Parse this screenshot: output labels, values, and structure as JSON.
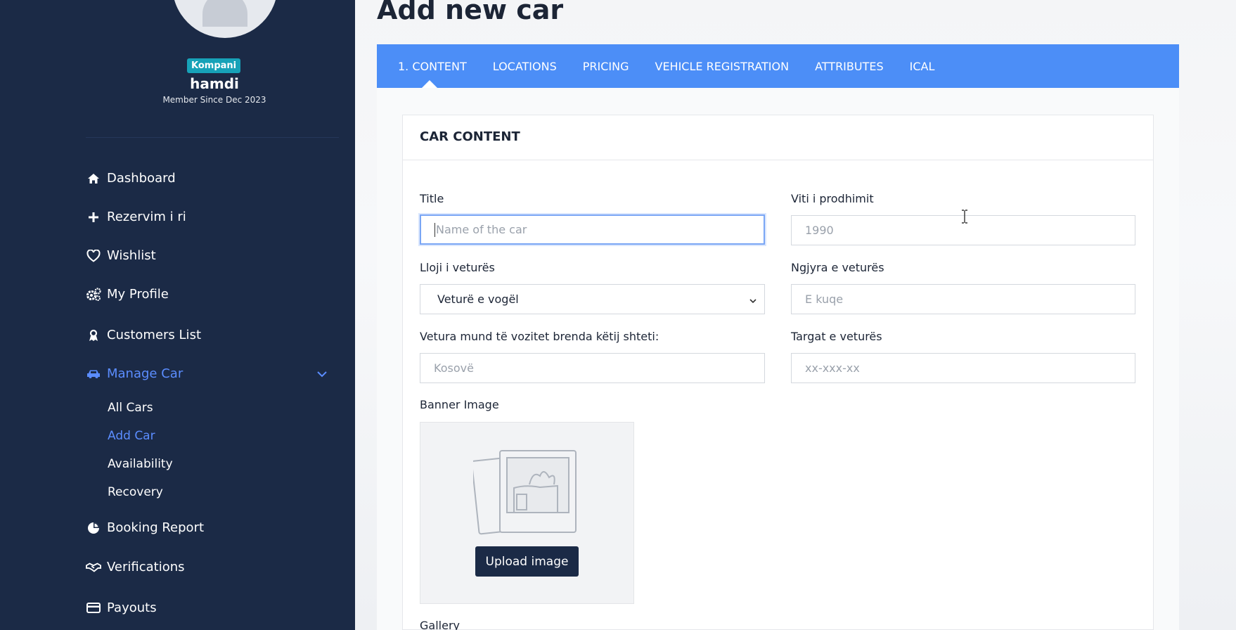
{
  "profile": {
    "badge": "Kompani",
    "username": "hamdi",
    "member_since": "Member Since Dec 2023"
  },
  "sidebar": {
    "items": [
      {
        "label": "Dashboard",
        "icon": "home-icon"
      },
      {
        "label": "Rezervim i ri",
        "icon": "plus-icon"
      },
      {
        "label": "Wishlist",
        "icon": "heart-icon"
      },
      {
        "label": "My Profile",
        "icon": "gears-icon"
      },
      {
        "label": "Customers List",
        "icon": "user-badge-icon"
      },
      {
        "label": "Manage Car",
        "icon": "car-icon",
        "active": true
      },
      {
        "label": "Booking Report",
        "icon": "pie-chart-icon"
      },
      {
        "label": "Verifications",
        "icon": "handshake-icon"
      },
      {
        "label": "Payouts",
        "icon": "credit-card-icon"
      }
    ],
    "sub_items": [
      {
        "label": "All Cars"
      },
      {
        "label": "Add Car",
        "active": true
      },
      {
        "label": "Availability"
      },
      {
        "label": "Recovery"
      }
    ]
  },
  "page": {
    "title": "Add new car"
  },
  "tabs": [
    {
      "label": "1. CONTENT",
      "active": true
    },
    {
      "label": "LOCATIONS"
    },
    {
      "label": "PRICING"
    },
    {
      "label": "VEHICLE REGISTRATION"
    },
    {
      "label": "ATTRIBUTES"
    },
    {
      "label": "ICAL"
    }
  ],
  "form": {
    "section_title": "CAR CONTENT",
    "title_label": "Title",
    "title_placeholder": "Name of the car",
    "year_label": "Viti i prodhimit",
    "year_placeholder": "1990",
    "type_label": "Lloji i veturës",
    "type_value": "Veturë e vogël",
    "color_label": "Ngjyra e veturës",
    "color_placeholder": "E kuqe",
    "country_label": "Vetura mund të vozitet brenda këtij shteti:",
    "country_placeholder": "Kosovë",
    "plates_label": "Targat e veturës",
    "plates_placeholder": "xx-xxx-xx",
    "banner_label": "Banner Image",
    "upload_label": "Upload image",
    "gallery_label": "Gallery"
  },
  "colors": {
    "sidebar_bg": "#1b2a46",
    "accent": "#4c8ef7",
    "active_link": "#5b8dff",
    "badge": "#17a2b8"
  }
}
